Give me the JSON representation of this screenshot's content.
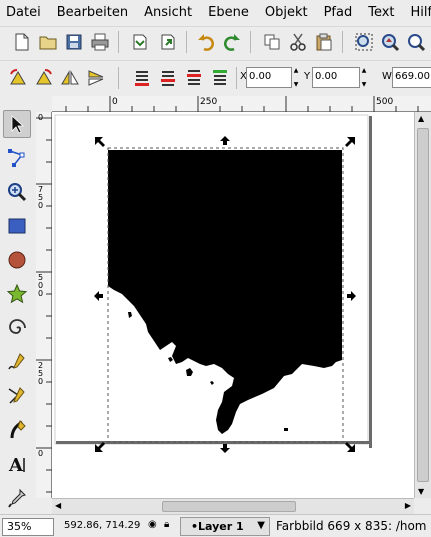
{
  "menubar": {
    "items": [
      "Datei",
      "Bearbeiten",
      "Ansicht",
      "Ebene",
      "Objekt",
      "Pfad",
      "Text",
      "Hilfe"
    ]
  },
  "controls": {
    "x_label": "X",
    "x_value": "0.00",
    "y_label": "Y",
    "y_value": "0.00",
    "w_label": "W",
    "w_value": "669.00"
  },
  "rulers": {
    "h_labels": [
      "0",
      "250",
      "500"
    ],
    "v_labels": [
      "0",
      "7\n5\n0",
      "5\n0\n0",
      "2\n5\n0",
      "0"
    ]
  },
  "statusbar": {
    "zoom": "35%",
    "coords": "592.86, 714.29",
    "layer": "•Layer 1",
    "message": "Farbbild 669 x 835: /hom"
  },
  "colors": {
    "shape": "#000000",
    "page_shadow": "#6a6a6a",
    "selection": "#555555"
  }
}
